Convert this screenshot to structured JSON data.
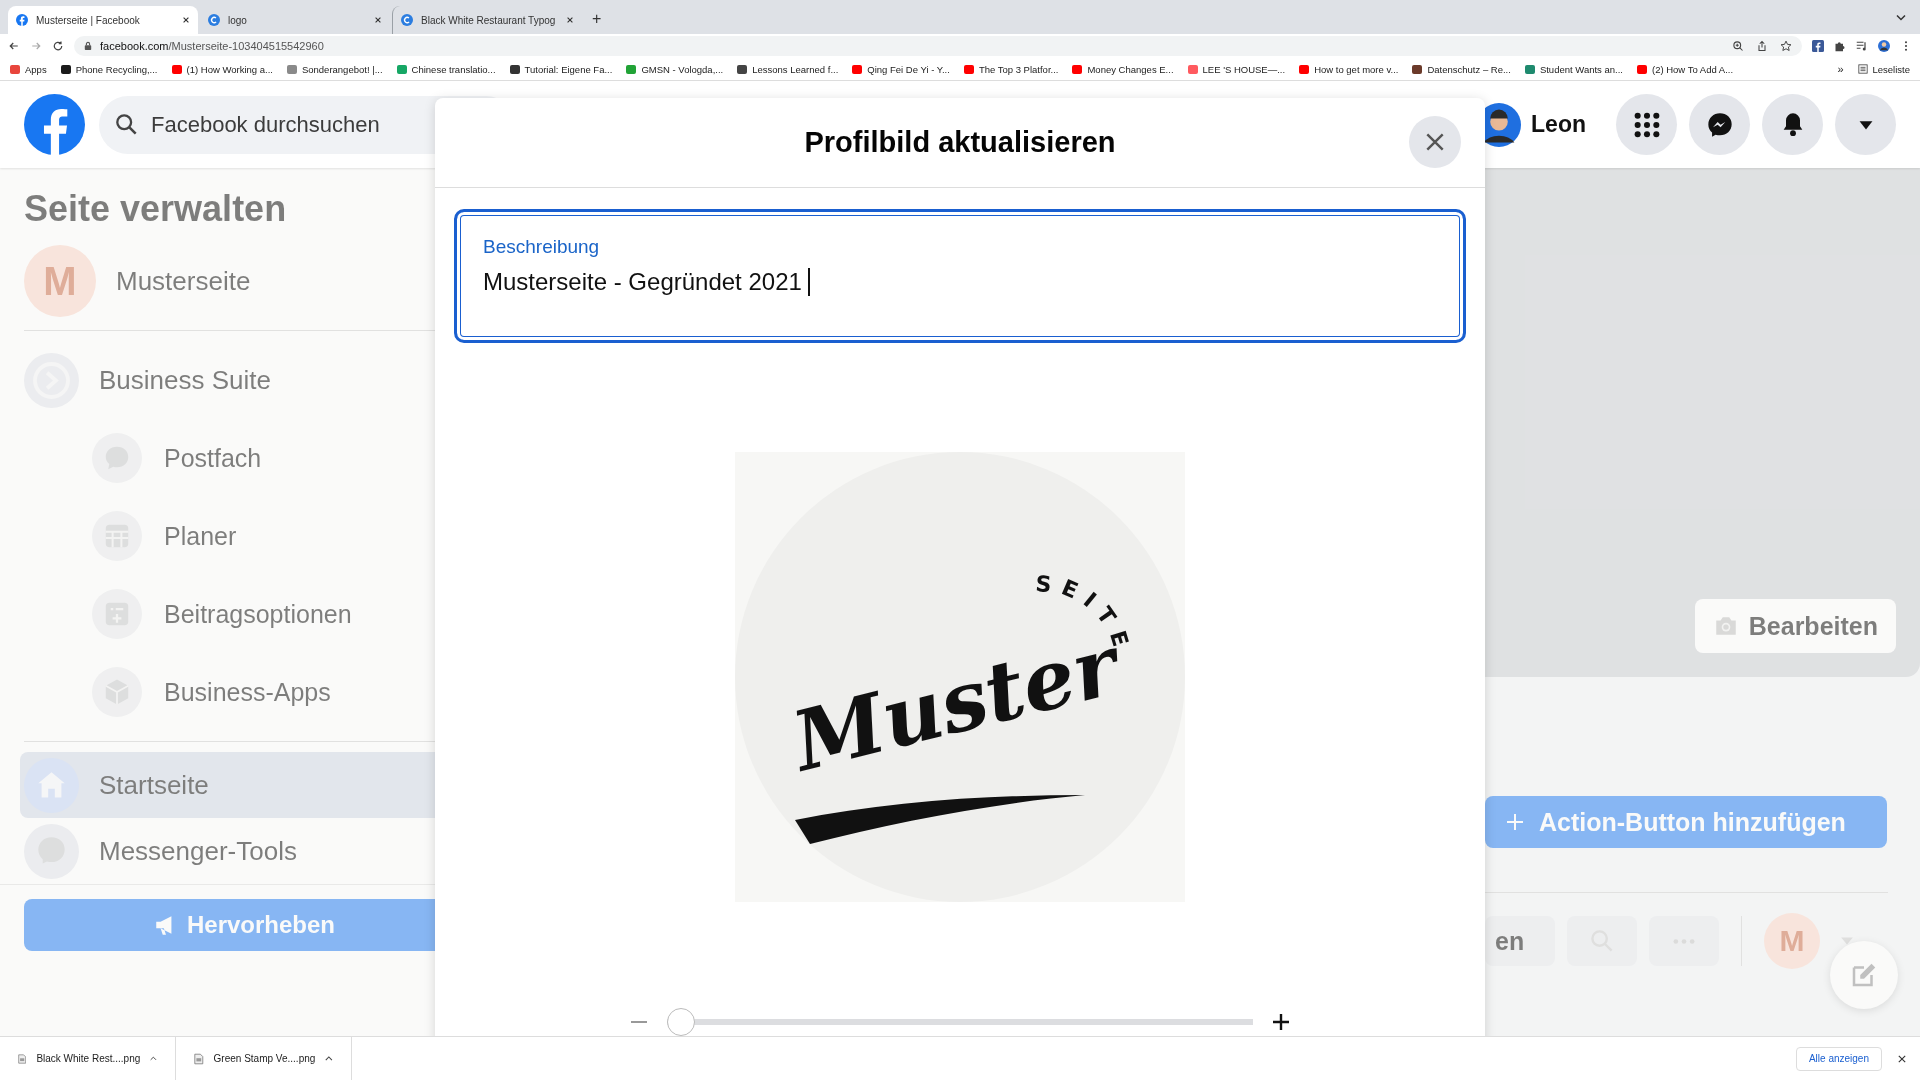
{
  "browser": {
    "tabs": [
      {
        "title": "Musterseite | Facebook",
        "selected": true,
        "kind": "facebook"
      },
      {
        "title": "logo",
        "selected": false,
        "kind": "canva"
      },
      {
        "title": "Black White Restaurant Typog",
        "selected": false,
        "kind": "canva"
      }
    ],
    "new_tab": "+",
    "url_host": "facebook.com",
    "url_path": "/Musterseite-103404515542960",
    "bookmarks": [
      {
        "label": "Apps",
        "color": "#e8453c"
      },
      {
        "label": "Phone Recycling,...",
        "color": "#1b1b1b"
      },
      {
        "label": "(1) How Working a...",
        "color": "#ff0000"
      },
      {
        "label": "Sonderangebot! |...",
        "color": "#8a8a8a"
      },
      {
        "label": "Chinese translatio...",
        "color": "#16a765"
      },
      {
        "label": "Tutorial: Eigene Fa...",
        "color": "#333333"
      },
      {
        "label": "GMSN - Vologda,...",
        "color": "#21a336"
      },
      {
        "label": "Lessons Learned f...",
        "color": "#444444"
      },
      {
        "label": "Qing Fei De Yi - Y...",
        "color": "#ff0000"
      },
      {
        "label": "The Top 3 Platfor...",
        "color": "#ff0000"
      },
      {
        "label": "Money Changes E...",
        "color": "#ff0000"
      },
      {
        "label": "LEE 'S HOUSE—...",
        "color": "#ff5a5f"
      },
      {
        "label": "How to get more v...",
        "color": "#ff0000"
      },
      {
        "label": "Datenschutz – Re...",
        "color": "#6b3a2a"
      },
      {
        "label": "Student Wants an...",
        "color": "#1e8a6e"
      },
      {
        "label": "(2) How To Add A...",
        "color": "#ff0000"
      }
    ],
    "more": "»",
    "reading_list": "Leseliste"
  },
  "header": {
    "search_placeholder": "Facebook durchsuchen",
    "user": "Leon"
  },
  "sidebar": {
    "title": "Seite verwalten",
    "page_initial": "M",
    "page_name": "Musterseite",
    "suite": "Business Suite",
    "suite_items": [
      {
        "label": "Postfach",
        "kind": "chat"
      },
      {
        "label": "Planer",
        "kind": "calendar"
      },
      {
        "label": "Beitragsoptionen",
        "kind": "post"
      },
      {
        "label": "Business-Apps",
        "kind": "box"
      }
    ],
    "nav": [
      {
        "label": "Startseite",
        "kind": "home",
        "selected": true
      },
      {
        "label": "Messenger-Tools",
        "kind": "messenger",
        "selected": false
      }
    ],
    "promote": "Hervorheben"
  },
  "main": {
    "edit_cover": "Bearbeiten",
    "action_button": "Action-Button hinzufügen",
    "tab_partial": "en",
    "avatar_initial": "M"
  },
  "modal": {
    "title": "Profilbild aktualisieren",
    "field_label": "Beschreibung",
    "field_value": "Musterseite - Gegründet 2021",
    "logo_word": "Muster",
    "logo_arc": "SEITE",
    "zoom": {
      "level": 0
    }
  },
  "downloads": {
    "items": [
      "Black White Rest....png",
      "Green Stamp Ve....png"
    ],
    "show_all": "Alle anzeigen"
  }
}
